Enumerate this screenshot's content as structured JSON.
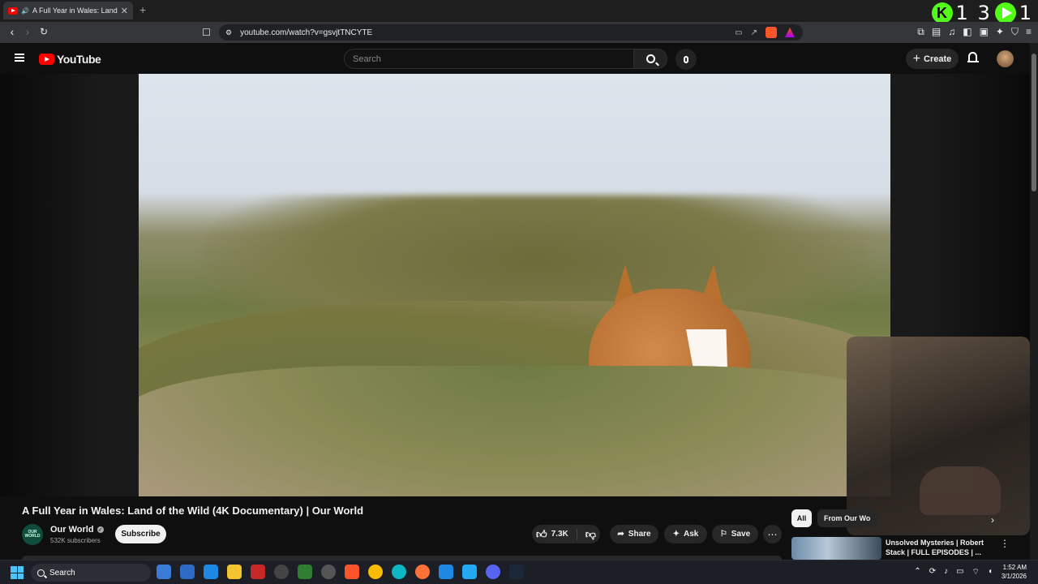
{
  "browser": {
    "tab_title": "A Full Year in Wales: Land of t",
    "tab_close": "✕",
    "new_tab": "+",
    "url": "youtube.com/watch?v=gsvjtTNCYTE",
    "overlay_count_left": "1 3",
    "overlay_count_right": "1"
  },
  "youtube": {
    "logo_text": "YouTube",
    "search_placeholder": "Search",
    "create_label": "Create"
  },
  "video": {
    "title": "A Full Year in Wales: Land of the Wild (4K Documentary) | Our World",
    "channel_name": "Our World",
    "channel_avatar_text": "OUR WORLD",
    "subscribers": "532K subscribers",
    "subscribe_label": "Subscribe",
    "likes": "7.3K",
    "share_label": "Share",
    "ask_label": "Ask",
    "save_label": "Save"
  },
  "sidebar": {
    "chip_all": "All",
    "chip_from": "From Our Wo",
    "rec_title": "Unsolved Mysteries | Robert Stack | FULL EPISODES | ..."
  },
  "taskbar": {
    "search_label": "Search",
    "time": "1:52 AM",
    "date": "3/1/2026"
  },
  "colors": {
    "accent": "#ff0000",
    "overlay_green": "#53fc18",
    "background": "#0f0f0f"
  }
}
